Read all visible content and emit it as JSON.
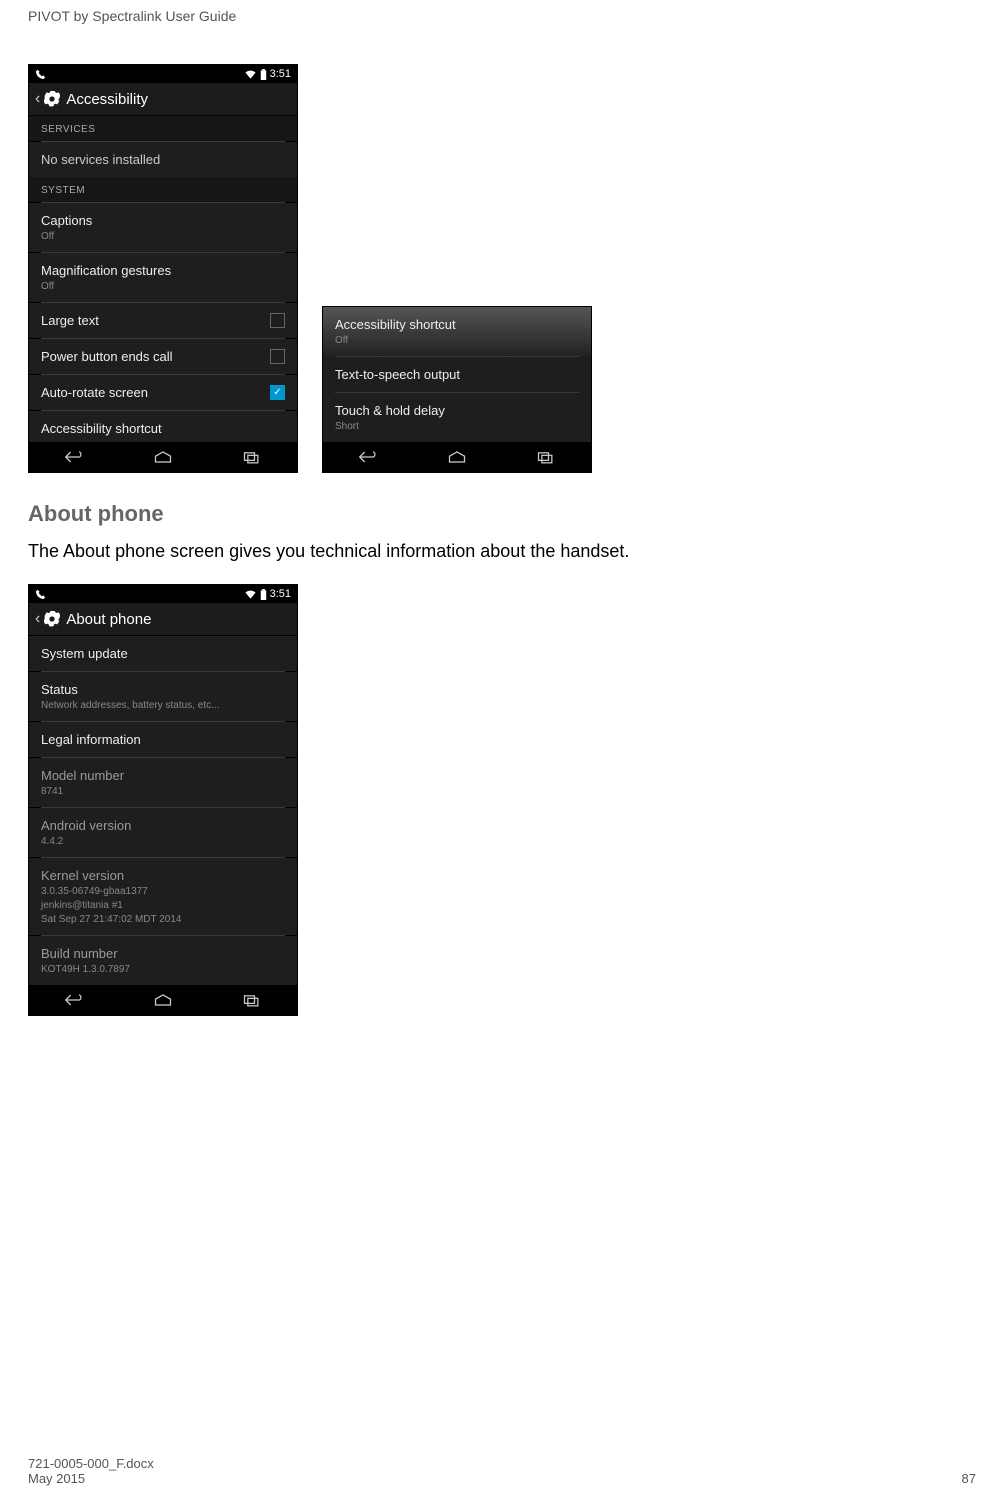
{
  "header": "PIVOT by Spectralink User Guide",
  "status_time": "3:51",
  "phone1": {
    "title": "Accessibility",
    "sec1": "SERVICES",
    "no_services": "No services installed",
    "sec2": "SYSTEM",
    "captions": "Captions",
    "captions_sub": "Off",
    "mag": "Magnification gestures",
    "mag_sub": "Off",
    "large": "Large text",
    "power": "Power button ends call",
    "autorotate": "Auto-rotate screen",
    "shortcut": "Accessibility shortcut"
  },
  "phone2": {
    "shortcut": "Accessibility shortcut",
    "shortcut_sub": "Off",
    "tts": "Text-to-speech output",
    "touch": "Touch & hold delay",
    "touch_sub": "Short"
  },
  "section_heading": "About phone",
  "body": "The About phone screen gives you technical information about the handset.",
  "phone3": {
    "title": "About phone",
    "sysupdate": "System update",
    "status": "Status",
    "status_sub": "Network addresses, battery status, etc...",
    "legal": "Legal information",
    "model": "Model number",
    "model_sub": "8741",
    "android": "Android version",
    "android_sub": "4.4.2",
    "kernel": "Kernel version",
    "kernel_sub1": "3.0.35-06749-gbaa1377",
    "kernel_sub2": "jenkins@titania #1",
    "kernel_sub3": "Sat Sep 27 21:47:02 MDT 2014",
    "build": "Build number",
    "build_sub": "KOT49H 1.3.0.7897"
  },
  "footer_doc": "721-0005-000_F.docx",
  "footer_date": "May 2015",
  "footer_page": "87"
}
